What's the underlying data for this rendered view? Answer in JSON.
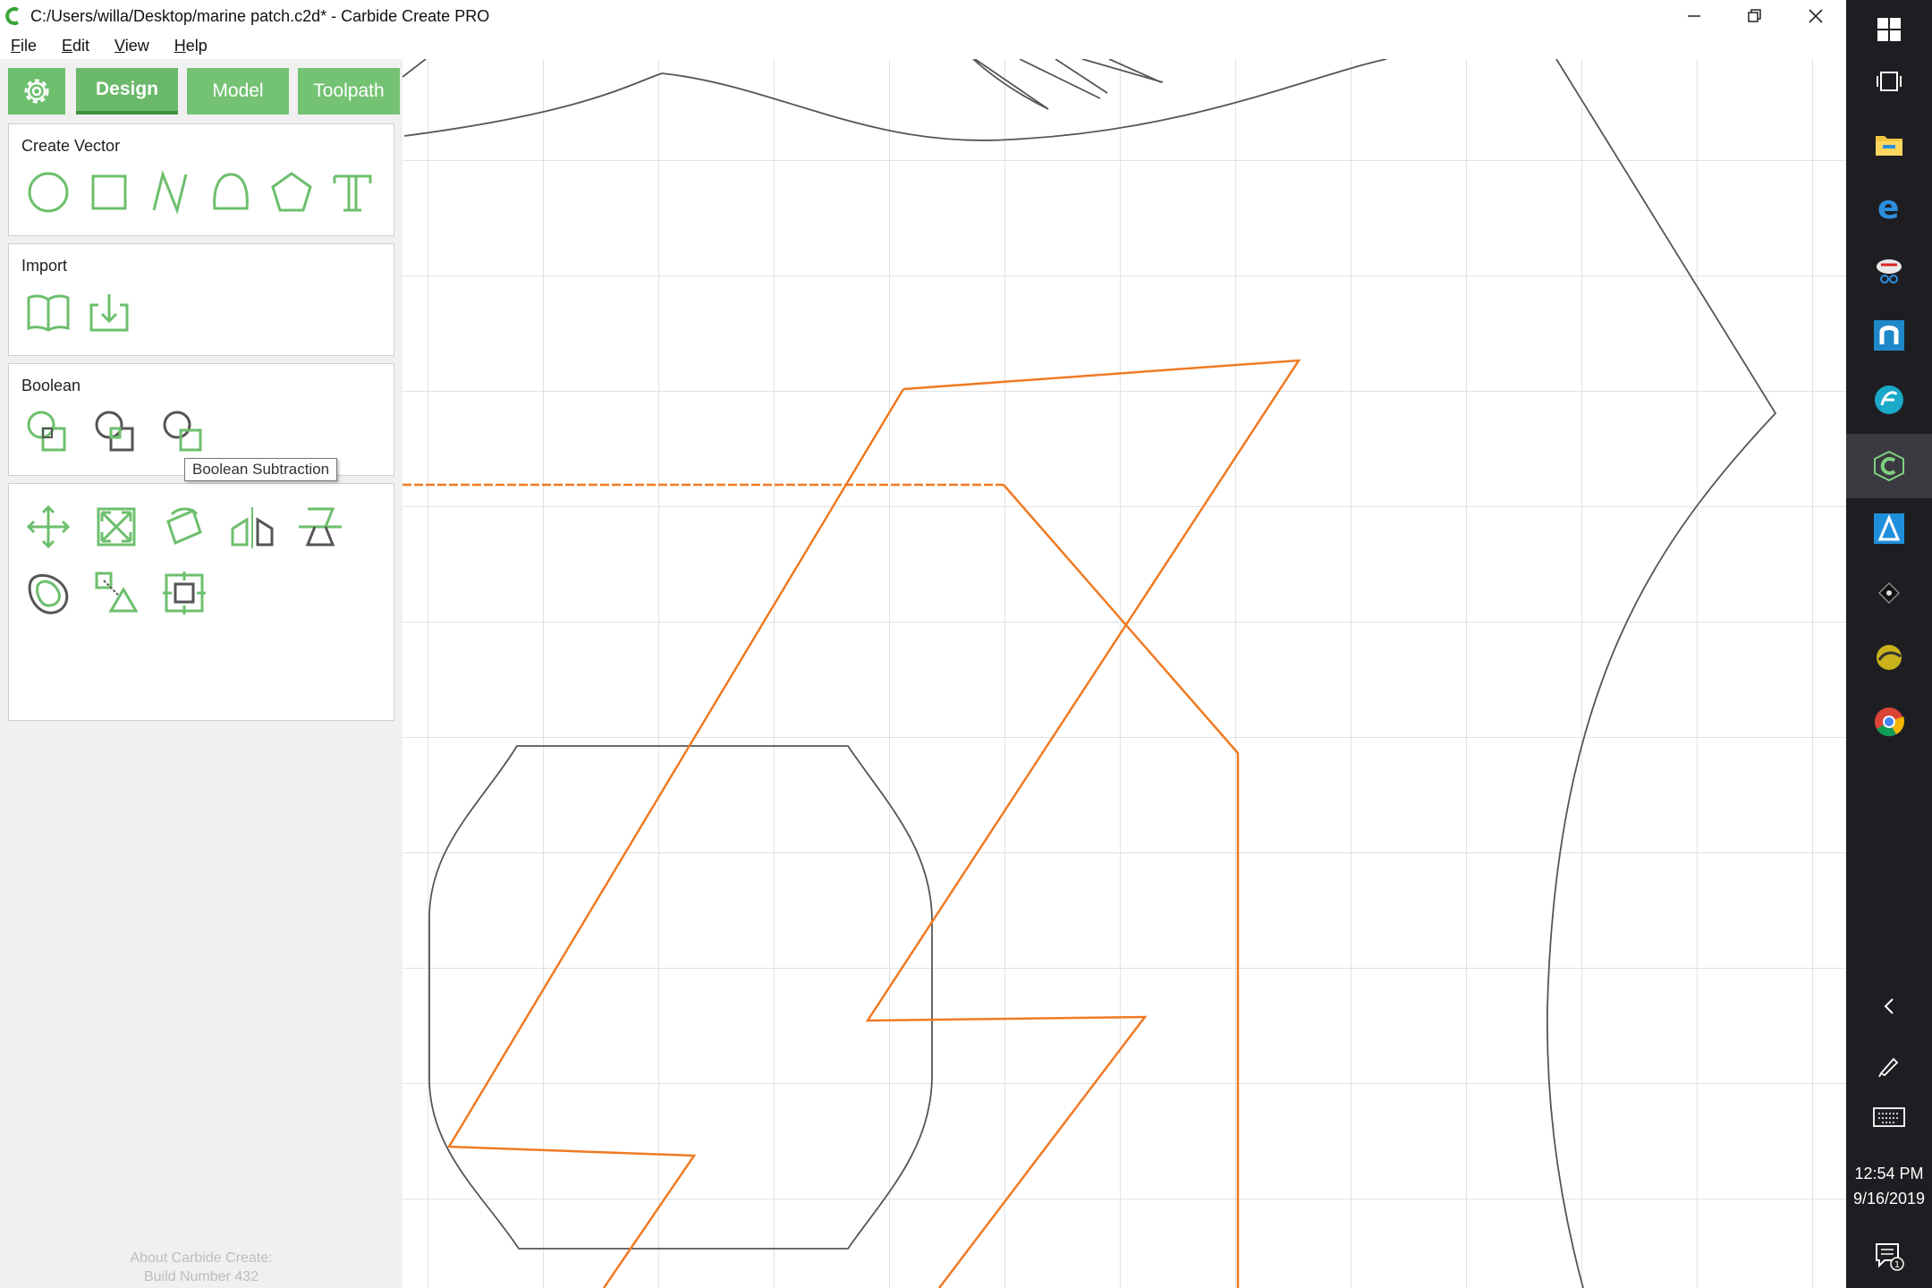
{
  "window": {
    "title": "C:/Users/willa/Desktop/marine patch.c2d* - Carbide Create PRO"
  },
  "menu": [
    "File",
    "Edit",
    "View",
    "Help"
  ],
  "tabs": {
    "design": "Design",
    "model": "Model",
    "toolpath": "Toolpath"
  },
  "sections": {
    "create_vector": "Create Vector",
    "import": "Import",
    "boolean": "Boolean"
  },
  "tooltip": "Boolean Subtraction",
  "about": {
    "line1": "About Carbide Create:",
    "line2": "Build Number 432"
  },
  "clock": {
    "time": "12:54 PM",
    "date": "9/16/2019"
  },
  "notifications": {
    "count": "1"
  },
  "colors": {
    "accent_green": "#74c274",
    "icon_green": "#6dbf6d",
    "selection_orange": "#f07a23",
    "vector_gray": "#555555",
    "grid": "#d8d8d8",
    "taskbar": "#1e1e22"
  }
}
